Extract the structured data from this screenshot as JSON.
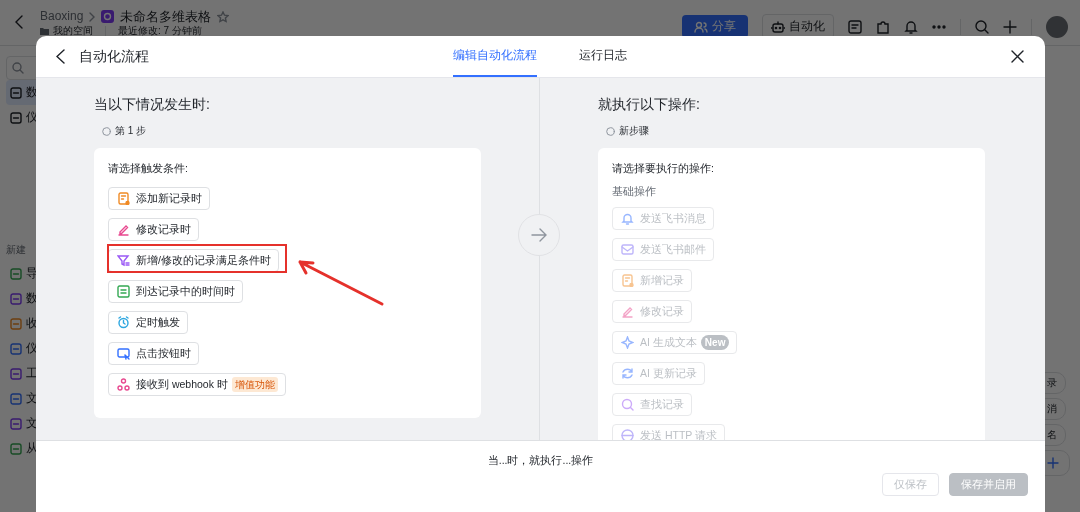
{
  "app_header": {
    "breadcrumb": "Baoxing",
    "doc_title": "未命名多维表格",
    "location": "我的空间",
    "modified": "最近修改: 7 分钟前",
    "share_button": "分享",
    "automation_button": "自动化"
  },
  "sidebar": {
    "top_items": [
      {
        "label": "数",
        "selected": true
      },
      {
        "label": "仪",
        "selected": false
      }
    ],
    "new_label": "新建",
    "new_items": [
      {
        "label": "导"
      },
      {
        "label": "数"
      },
      {
        "label": "收"
      },
      {
        "label": "仪"
      },
      {
        "label": "工"
      },
      {
        "label": "文"
      },
      {
        "label": "文"
      },
      {
        "label": "从"
      }
    ]
  },
  "right_strip": {
    "items": [
      "录",
      "消",
      "名"
    ]
  },
  "dialog": {
    "title": "自动化流程",
    "tabs": [
      {
        "label": "编辑自动化流程",
        "selected": true
      },
      {
        "label": "运行日志",
        "selected": false
      }
    ],
    "trigger_panel": {
      "heading": "当以下情况发生时:",
      "step": "第 1 步",
      "prompt": "请选择触发条件:",
      "items": [
        {
          "label": "添加新记录时",
          "highlighted": false
        },
        {
          "label": "修改记录时",
          "highlighted": false
        },
        {
          "label": "新增/修改的记录满足条件时",
          "highlighted": true
        },
        {
          "label": "到达记录中的时间时",
          "highlighted": false
        },
        {
          "label": "定时触发",
          "highlighted": false
        },
        {
          "label": "点击按钮时",
          "highlighted": false
        },
        {
          "label": "接收到 webhook 时",
          "highlighted": false,
          "badge": "增值功能"
        }
      ]
    },
    "action_panel": {
      "heading": "就执行以下操作:",
      "step": "新步骤",
      "prompt": "请选择要执行的操作:",
      "group": "基础操作",
      "items": [
        {
          "label": "发送飞书消息",
          "disabled": true
        },
        {
          "label": "发送飞书邮件",
          "disabled": true
        },
        {
          "label": "新增记录",
          "disabled": true
        },
        {
          "label": "修改记录",
          "disabled": true
        },
        {
          "label": "AI 生成文本",
          "disabled": true,
          "badge": "New"
        },
        {
          "label": "AI 更新记录",
          "disabled": true
        },
        {
          "label": "查找记录",
          "disabled": true
        },
        {
          "label": "发送 HTTP 请求",
          "disabled": true
        }
      ]
    },
    "footer": {
      "summary": "当...时，就执行...操作",
      "buttons": [
        {
          "label": "仅保存",
          "kind": "secondary",
          "disabled": true
        },
        {
          "label": "保存并启用",
          "kind": "primary",
          "disabled": true
        }
      ]
    }
  }
}
